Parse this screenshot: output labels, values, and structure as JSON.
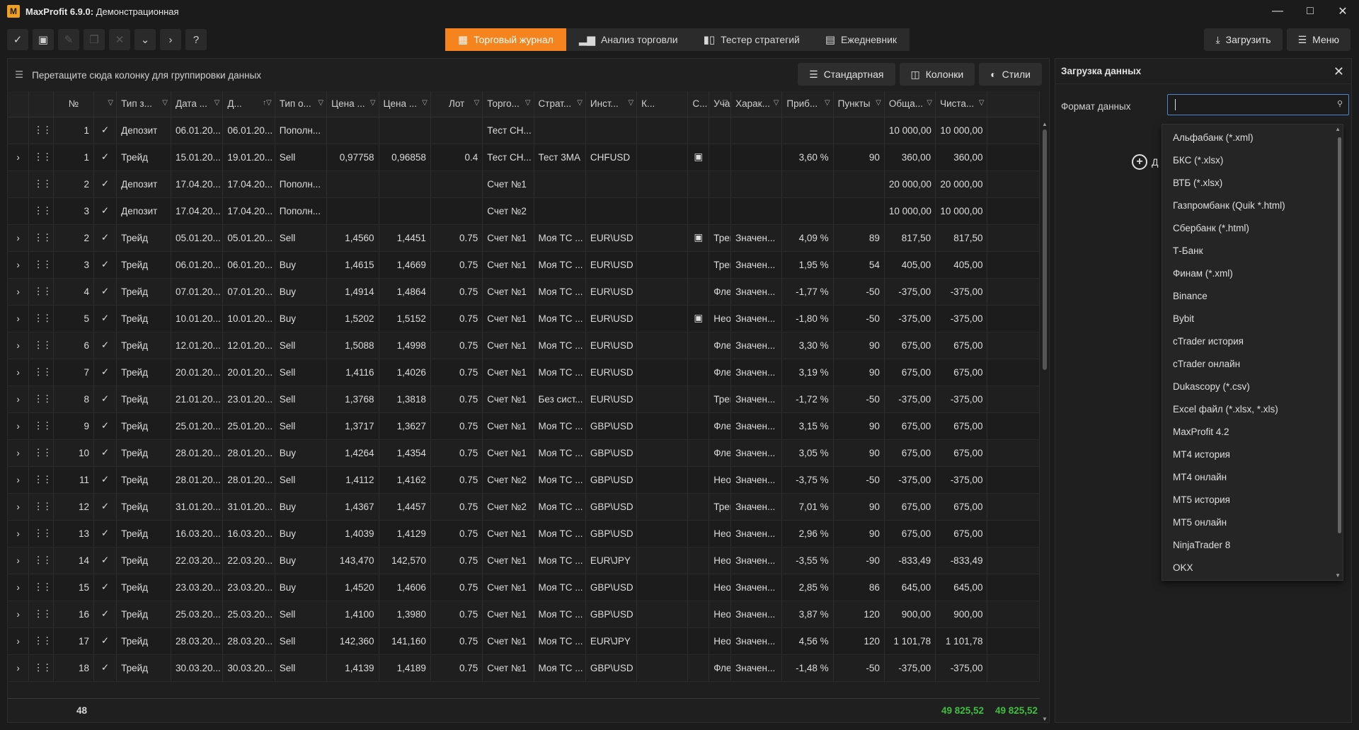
{
  "window": {
    "app_name": "MaxProfit 6.9.0:",
    "mode": " Демонстрационная",
    "logo_letter": "M"
  },
  "tabs": [
    {
      "label": "Торговый журнал",
      "icon": "table-icon",
      "active": true
    },
    {
      "label": "Анализ торговли",
      "icon": "bar-chart-icon",
      "active": false
    },
    {
      "label": "Тестер стратегий",
      "icon": "candles-icon",
      "active": false
    },
    {
      "label": "Ежедневник",
      "icon": "calendar-icon",
      "active": false
    }
  ],
  "toolbar_right": {
    "load": "Загрузить",
    "menu": "Меню"
  },
  "group_bar": {
    "hint": "Перетащите сюда колонку для группировки данных",
    "standard": "Стандартная",
    "columns": "Колонки",
    "styles": "Стили"
  },
  "columns": [
    "№",
    "",
    "Тип з...",
    "Дата ...",
    "Д...",
    "Тип о...",
    "Цена ...",
    "Цена ...",
    "Лот",
    "Торго...",
    "Страт...",
    "Инст...",
    "К...",
    "С...",
    "Участ...",
    "Харак...",
    "Приб...",
    "Пункты",
    "Обща...",
    "Чиста..."
  ],
  "rows": [
    {
      "exp": "",
      "n": "1",
      "type": "Депозит",
      "d1": "06.01.20...",
      "d2": "06.01.20...",
      "op": "Пополн...",
      "p1": "",
      "p2": "",
      "lot": "",
      "acc": "Тест СН...",
      "strat": "",
      "inst": "",
      "k": "",
      "s": "",
      "part": "",
      "char": "",
      "prof": "",
      "pts": "",
      "tot": "10 000,00",
      "net": "10 000,00",
      "sign": ""
    },
    {
      "exp": "›",
      "n": "1",
      "type": "Трейд",
      "d1": "15.01.20...",
      "d2": "19.01.20...",
      "op": "Sell",
      "p1": "0,97758",
      "p2": "0,96858",
      "lot": "0.4",
      "acc": "Тест СН...",
      "strat": "Тест 3MA",
      "inst": "CHFUSD",
      "k": "",
      "s": "img",
      "part": "",
      "char": "",
      "prof": "3,60 %",
      "pts": "90",
      "tot": "360,00",
      "net": "360,00",
      "sign": "pos"
    },
    {
      "exp": "",
      "n": "2",
      "type": "Депозит",
      "d1": "17.04.20...",
      "d2": "17.04.20...",
      "op": "Пополн...",
      "p1": "",
      "p2": "",
      "lot": "",
      "acc": "Счет №1",
      "strat": "",
      "inst": "",
      "k": "",
      "s": "",
      "part": "",
      "char": "",
      "prof": "",
      "pts": "",
      "tot": "20 000,00",
      "net": "20 000,00",
      "sign": ""
    },
    {
      "exp": "",
      "n": "3",
      "type": "Депозит",
      "d1": "17.04.20...",
      "d2": "17.04.20...",
      "op": "Пополн...",
      "p1": "",
      "p2": "",
      "lot": "",
      "acc": "Счет №2",
      "strat": "",
      "inst": "",
      "k": "",
      "s": "",
      "part": "",
      "char": "",
      "prof": "",
      "pts": "",
      "tot": "10 000,00",
      "net": "10 000,00",
      "sign": ""
    },
    {
      "exp": "›",
      "n": "2",
      "type": "Трейд",
      "d1": "05.01.20...",
      "d2": "05.01.20...",
      "op": "Sell",
      "p1": "1,4560",
      "p2": "1,4451",
      "lot": "0.75",
      "acc": "Счет №1",
      "strat": "Моя ТС ...",
      "inst": "EUR\\USD",
      "k": "",
      "s": "img",
      "part": "Тренд",
      "char": "Значен...",
      "prof": "4,09 %",
      "pts": "89",
      "tot": "817,50",
      "net": "817,50",
      "sign": "pos"
    },
    {
      "exp": "›",
      "n": "3",
      "type": "Трейд",
      "d1": "06.01.20...",
      "d2": "06.01.20...",
      "op": "Buy",
      "p1": "1,4615",
      "p2": "1,4669",
      "lot": "0.75",
      "acc": "Счет №1",
      "strat": "Моя ТС ...",
      "inst": "EUR\\USD",
      "k": "",
      "s": "",
      "part": "Тренд",
      "char": "Значен...",
      "prof": "1,95 %",
      "pts": "54",
      "tot": "405,00",
      "net": "405,00",
      "sign": "pos"
    },
    {
      "exp": "›",
      "n": "4",
      "type": "Трейд",
      "d1": "07.01.20...",
      "d2": "07.01.20...",
      "op": "Buy",
      "p1": "1,4914",
      "p2": "1,4864",
      "lot": "0.75",
      "acc": "Счет №1",
      "strat": "Моя ТС ...",
      "inst": "EUR\\USD",
      "k": "",
      "s": "",
      "part": "Флет",
      "char": "Значен...",
      "prof": "-1,77 %",
      "pts": "-50",
      "tot": "-375,00",
      "net": "-375,00",
      "sign": "neg"
    },
    {
      "exp": "›",
      "n": "5",
      "type": "Трейд",
      "d1": "10.01.20...",
      "d2": "10.01.20...",
      "op": "Buy",
      "p1": "1,5202",
      "p2": "1,5152",
      "lot": "0.75",
      "acc": "Счет №1",
      "strat": "Моя ТС ...",
      "inst": "EUR\\USD",
      "k": "",
      "s": "img",
      "part": "Неопре...",
      "char": "Значен...",
      "prof": "-1,80 %",
      "pts": "-50",
      "tot": "-375,00",
      "net": "-375,00",
      "sign": "neg"
    },
    {
      "exp": "›",
      "n": "6",
      "type": "Трейд",
      "d1": "12.01.20...",
      "d2": "12.01.20...",
      "op": "Sell",
      "p1": "1,5088",
      "p2": "1,4998",
      "lot": "0.75",
      "acc": "Счет №1",
      "strat": "Моя ТС ...",
      "inst": "EUR\\USD",
      "k": "",
      "s": "",
      "part": "Флет",
      "char": "Значен...",
      "prof": "3,30 %",
      "pts": "90",
      "tot": "675,00",
      "net": "675,00",
      "sign": "pos"
    },
    {
      "exp": "›",
      "n": "7",
      "type": "Трейд",
      "d1": "20.01.20...",
      "d2": "20.01.20...",
      "op": "Sell",
      "p1": "1,4116",
      "p2": "1,4026",
      "lot": "0.75",
      "acc": "Счет №1",
      "strat": "Моя ТС ...",
      "inst": "EUR\\USD",
      "k": "",
      "s": "",
      "part": "Флет",
      "char": "Значен...",
      "prof": "3,19 %",
      "pts": "90",
      "tot": "675,00",
      "net": "675,00",
      "sign": "pos"
    },
    {
      "exp": "›",
      "n": "8",
      "type": "Трейд",
      "d1": "21.01.20...",
      "d2": "23.01.20...",
      "op": "Sell",
      "p1": "1,3768",
      "p2": "1,3818",
      "lot": "0.75",
      "acc": "Счет №1",
      "strat": "Без сист...",
      "inst": "EUR\\USD",
      "k": "",
      "s": "",
      "part": "Тренд",
      "char": "Значен...",
      "prof": "-1,72 %",
      "pts": "-50",
      "tot": "-375,00",
      "net": "-375,00",
      "sign": "neg"
    },
    {
      "exp": "›",
      "n": "9",
      "type": "Трейд",
      "d1": "25.01.20...",
      "d2": "25.01.20...",
      "op": "Sell",
      "p1": "1,3717",
      "p2": "1,3627",
      "lot": "0.75",
      "acc": "Счет №1",
      "strat": "Моя ТС ...",
      "inst": "GBP\\USD",
      "k": "",
      "s": "",
      "part": "Флет",
      "char": "Значен...",
      "prof": "3,15 %",
      "pts": "90",
      "tot": "675,00",
      "net": "675,00",
      "sign": "pos"
    },
    {
      "exp": "›",
      "n": "10",
      "type": "Трейд",
      "d1": "28.01.20...",
      "d2": "28.01.20...",
      "op": "Buy",
      "p1": "1,4264",
      "p2": "1,4354",
      "lot": "0.75",
      "acc": "Счет №1",
      "strat": "Моя ТС ...",
      "inst": "GBP\\USD",
      "k": "",
      "s": "",
      "part": "Флет",
      "char": "Значен...",
      "prof": "3,05 %",
      "pts": "90",
      "tot": "675,00",
      "net": "675,00",
      "sign": "pos"
    },
    {
      "exp": "›",
      "n": "11",
      "type": "Трейд",
      "d1": "28.01.20...",
      "d2": "28.01.20...",
      "op": "Sell",
      "p1": "1,4112",
      "p2": "1,4162",
      "lot": "0.75",
      "acc": "Счет №2",
      "strat": "Моя ТС ...",
      "inst": "GBP\\USD",
      "k": "",
      "s": "",
      "part": "Неопре...",
      "char": "Значен...",
      "prof": "-3,75 %",
      "pts": "-50",
      "tot": "-375,00",
      "net": "-375,00",
      "sign": "neg"
    },
    {
      "exp": "›",
      "n": "12",
      "type": "Трейд",
      "d1": "31.01.20...",
      "d2": "31.01.20...",
      "op": "Buy",
      "p1": "1,4367",
      "p2": "1,4457",
      "lot": "0.75",
      "acc": "Счет №2",
      "strat": "Моя ТС ...",
      "inst": "GBP\\USD",
      "k": "",
      "s": "",
      "part": "Тренд",
      "char": "Значен...",
      "prof": "7,01 %",
      "pts": "90",
      "tot": "675,00",
      "net": "675,00",
      "sign": "pos"
    },
    {
      "exp": "›",
      "n": "13",
      "type": "Трейд",
      "d1": "16.03.20...",
      "d2": "16.03.20...",
      "op": "Buy",
      "p1": "1,4039",
      "p2": "1,4129",
      "lot": "0.75",
      "acc": "Счет №1",
      "strat": "Моя ТС ...",
      "inst": "GBP\\USD",
      "k": "",
      "s": "",
      "part": "Неопре...",
      "char": "Значен...",
      "prof": "2,96 %",
      "pts": "90",
      "tot": "675,00",
      "net": "675,00",
      "sign": "pos"
    },
    {
      "exp": "›",
      "n": "14",
      "type": "Трейд",
      "d1": "22.03.20...",
      "d2": "22.03.20...",
      "op": "Buy",
      "p1": "143,470",
      "p2": "142,570",
      "lot": "0.75",
      "acc": "Счет №1",
      "strat": "Моя ТС ...",
      "inst": "EUR\\JPY",
      "k": "",
      "s": "",
      "part": "Неопре...",
      "char": "Значен...",
      "prof": "-3,55 %",
      "pts": "-90",
      "tot": "-833,49",
      "net": "-833,49",
      "sign": "neg"
    },
    {
      "exp": "›",
      "n": "15",
      "type": "Трейд",
      "d1": "23.03.20...",
      "d2": "23.03.20...",
      "op": "Buy",
      "p1": "1,4520",
      "p2": "1,4606",
      "lot": "0.75",
      "acc": "Счет №1",
      "strat": "Моя ТС ...",
      "inst": "GBP\\USD",
      "k": "",
      "s": "",
      "part": "Неопре...",
      "char": "Значен...",
      "prof": "2,85 %",
      "pts": "86",
      "tot": "645,00",
      "net": "645,00",
      "sign": "pos"
    },
    {
      "exp": "›",
      "n": "16",
      "type": "Трейд",
      "d1": "25.03.20...",
      "d2": "25.03.20...",
      "op": "Sell",
      "p1": "1,4100",
      "p2": "1,3980",
      "lot": "0.75",
      "acc": "Счет №1",
      "strat": "Моя ТС ...",
      "inst": "GBP\\USD",
      "k": "",
      "s": "",
      "part": "Неопре...",
      "char": "Значен...",
      "prof": "3,87 %",
      "pts": "120",
      "tot": "900,00",
      "net": "900,00",
      "sign": "pos"
    },
    {
      "exp": "›",
      "n": "17",
      "type": "Трейд",
      "d1": "28.03.20...",
      "d2": "28.03.20...",
      "op": "Sell",
      "p1": "142,360",
      "p2": "141,160",
      "lot": "0.75",
      "acc": "Счет №1",
      "strat": "Моя ТС ...",
      "inst": "EUR\\JPY",
      "k": "",
      "s": "",
      "part": "Неопре...",
      "char": "Значен...",
      "prof": "4,56 %",
      "pts": "120",
      "tot": "1 101,78",
      "net": "1 101,78",
      "sign": "pos"
    },
    {
      "exp": "›",
      "n": "18",
      "type": "Трейд",
      "d1": "30.03.20...",
      "d2": "30.03.20...",
      "op": "Sell",
      "p1": "1,4139",
      "p2": "1,4189",
      "lot": "0.75",
      "acc": "Счет №1",
      "strat": "Моя ТС ...",
      "inst": "GBP\\USD",
      "k": "",
      "s": "",
      "part": "Флет",
      "char": "Значен...",
      "prof": "-1,48 %",
      "pts": "-50",
      "tot": "-375,00",
      "net": "-375,00",
      "sign": "neg"
    }
  ],
  "footer": {
    "count": "48",
    "total": "49 825,52",
    "net": "49 825,52"
  },
  "side_panel": {
    "title": "Загрузка данных",
    "format_label": "Формат данных",
    "add_label": "Д"
  },
  "formats": [
    "Альфабанк (*.xml)",
    "БКС (*.xlsx)",
    "ВТБ (*.xlsx)",
    "Газпромбанк (Quik *.html)",
    "Сбербанк (*.html)",
    "Т-Банк",
    "Финам (*.xml)",
    "Binance",
    "Bybit",
    "cTrader история",
    "cTrader онлайн",
    "Dukascopy (*.csv)",
    "Excel файл (*.xlsx, *.xls)",
    "MaxProfit 4.2",
    "MT4 история",
    "MT4 онлайн",
    "MT5 история",
    "MT5 онлайн",
    "NinjaTrader 8",
    "OKX"
  ],
  "colors": {
    "accent": "#f5841f",
    "positive": "#3fbf3f",
    "negative": "#e03c3c",
    "focus": "#4a86d0"
  }
}
